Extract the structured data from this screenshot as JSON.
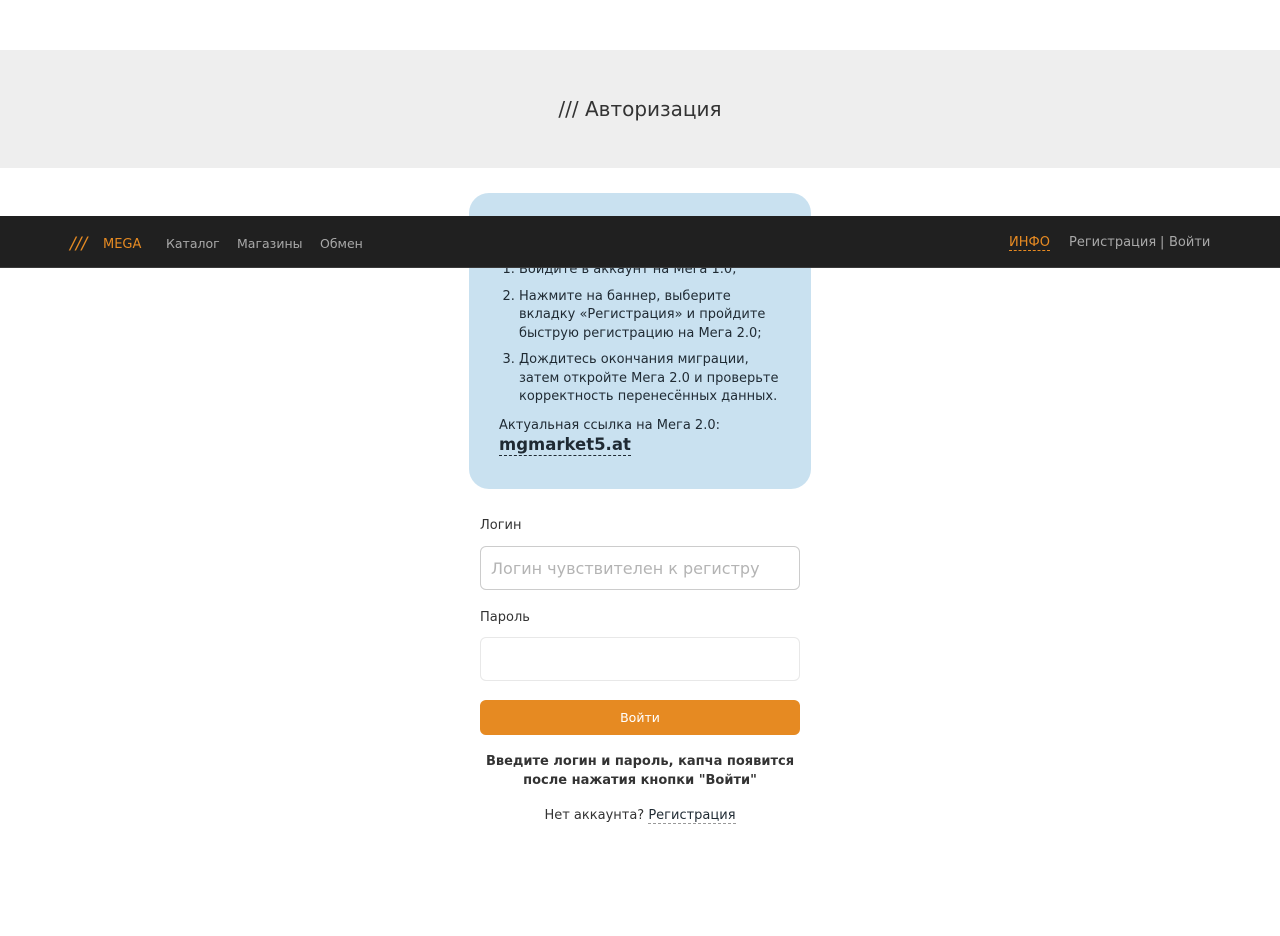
{
  "header": {
    "title": "/// Авторизация"
  },
  "info_box": {
    "steps": [
      "Войдите в аккаунт на Мега 1.0;",
      "Нажмите на баннер, выберите вкладку «Регистрация» и пройдите быструю регистрацию на Мега 2.0;",
      "Дождитесь окончания миграции, затем откройте Мега 2.0 и проверьте корректность перенесённых данных."
    ],
    "link_label": "Актуальная ссылка на Мега 2.0:",
    "link_text": "mgmarket5.at"
  },
  "navbar": {
    "logo_mark": "///",
    "logo_text": "MEGA",
    "items": [
      "Каталог",
      "Магазины",
      "Обмен"
    ],
    "info": "ИНФО",
    "register": "Регистрация",
    "separator": "|",
    "login": "Войти"
  },
  "form": {
    "login_label": "Логин",
    "login_placeholder": "Логин чувствителен к регистру",
    "login_value": "",
    "password_label": "Пароль",
    "password_value": "",
    "submit_label": "Войти",
    "hint": "Введите логин и пароль, капча появится после нажатия кнопки \"Войти\"",
    "no_account": "Нет аккаунта?",
    "signup_link": "Регистрация"
  },
  "colors": {
    "accent": "#e68a22",
    "navbar_bg": "#202020",
    "info_bg": "#c9e1f0",
    "header_bg": "#eeeeee"
  }
}
